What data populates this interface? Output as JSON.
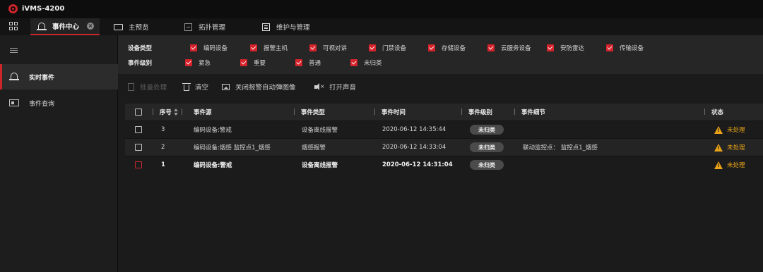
{
  "app": {
    "title": "iVMS-4200"
  },
  "tabs": [
    {
      "label": "事件中心",
      "active": true
    },
    {
      "label": "主预览"
    },
    {
      "label": "拓扑管理"
    },
    {
      "label": "维护与管理"
    }
  ],
  "sidebar": {
    "items": [
      {
        "label": "实时事件",
        "active": true
      },
      {
        "label": "事件查询"
      }
    ]
  },
  "filters": {
    "device_type": {
      "label": "设备类型",
      "options": [
        "编码设备",
        "报警主机",
        "可视对讲",
        "门禁设备",
        "存储设备",
        "云服务设备",
        "安防雷达",
        "传输设备"
      ]
    },
    "event_level": {
      "label": "事件级别",
      "options": [
        "紧急",
        "重要",
        "普通",
        "未归类"
      ]
    }
  },
  "toolbar": {
    "batch_label": "批量处理",
    "clear_label": "清空",
    "auto_popup_label": "关闭报警自动弹图像",
    "sound_label": "打开声音"
  },
  "table": {
    "headers": {
      "index": "序号",
      "source": "事件源",
      "type": "事件类型",
      "time": "事件时间",
      "level": "事件级别",
      "detail": "事件细节",
      "status": "状态"
    },
    "rows": [
      {
        "index": "3",
        "source": "编码设备:警戒",
        "type": "设备离线报警",
        "time": "2020-06-12 14:35:44",
        "level": "未归类",
        "detail": "",
        "status": "未处理"
      },
      {
        "index": "2",
        "source": "编码设备:烟感 监控点1_烟感",
        "type": "烟感报警",
        "time": "2020-06-12 14:33:04",
        "level": "未归类",
        "detail": "联动监控点： 监控点1_烟感",
        "status": "未处理"
      },
      {
        "index": "1",
        "source": "编码设备:警戒",
        "type": "设备离线报警",
        "time": "2020-06-12 14:31:04",
        "level": "未归类",
        "detail": "",
        "status": "未处理"
      }
    ]
  },
  "colors": {
    "accent": "#d0242b",
    "warning": "#e8a317",
    "background": "#141414"
  }
}
